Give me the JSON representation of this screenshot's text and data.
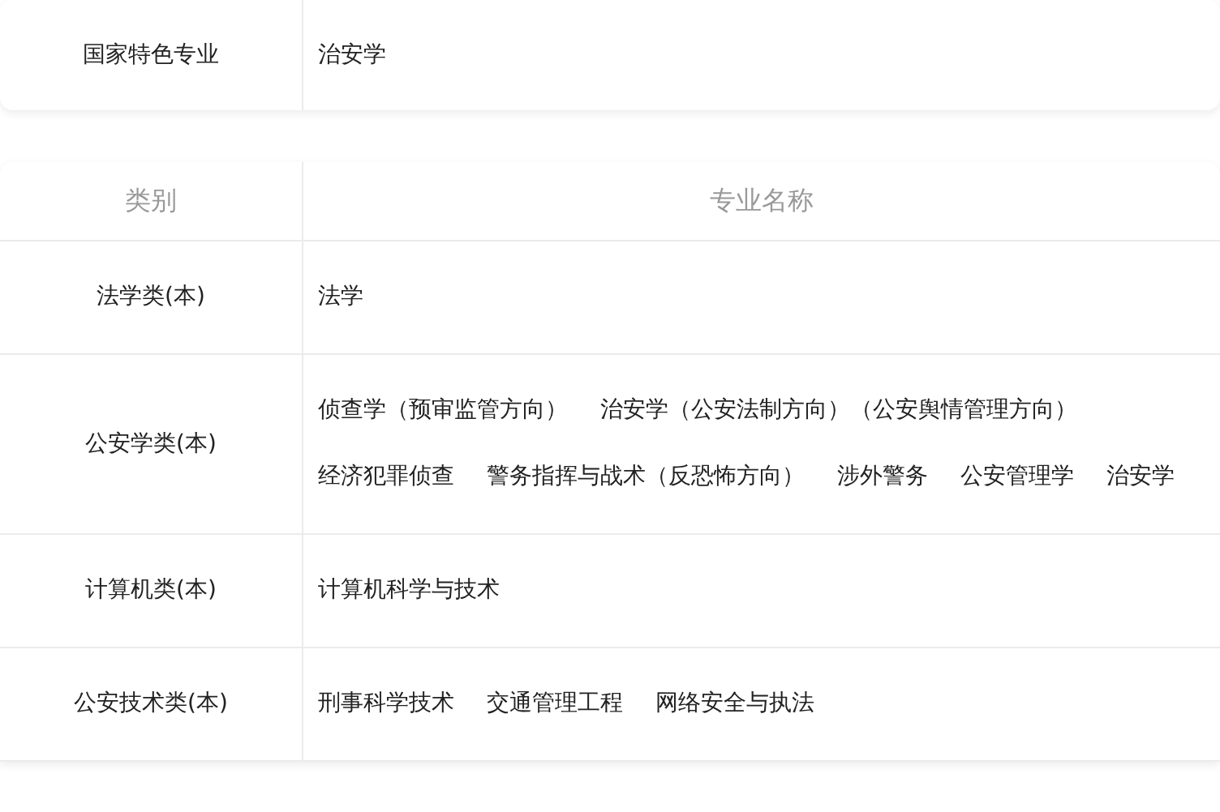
{
  "feature_card": {
    "label": "国家特色专业",
    "value": "治安学"
  },
  "majors_table": {
    "columns": [
      "类别",
      "专业名称"
    ],
    "rows": [
      {
        "category": "法学类(本)",
        "majors": [
          "法学"
        ]
      },
      {
        "category": "公安学类(本)",
        "majors": [
          "侦查学（预审监管方向）",
          "治安学（公安法制方向）（公安舆情管理方向）",
          "经济犯罪侦查",
          "警务指挥与战术（反恐怖方向）",
          "涉外警务",
          "公安管理学",
          "治安学"
        ]
      },
      {
        "category": "计算机类(本)",
        "majors": [
          "计算机科学与技术"
        ]
      },
      {
        "category": "公安技术类(本)",
        "majors": [
          "刑事科学技术",
          "交通管理工程",
          "网络安全与执法"
        ]
      }
    ]
  }
}
